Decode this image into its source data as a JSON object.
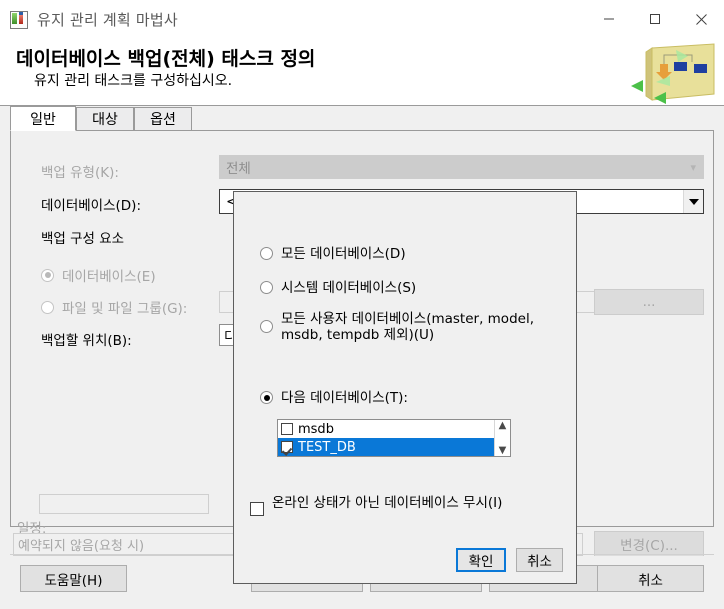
{
  "window": {
    "title": "유지 관리 계획 마법사",
    "icon": "maintenance-plan-icon",
    "minimize_label": "최소화",
    "maximize_label": "최대화",
    "close_label": "닫기"
  },
  "banner": {
    "title": "데이터베이스 백업(전체) 태스크 정의",
    "subtitle": "유지 관리 태스크를 구성하십시오."
  },
  "tabs": [
    {
      "label": "일반",
      "selected": true
    },
    {
      "label": "대상",
      "selected": false
    },
    {
      "label": "옵션",
      "selected": false
    }
  ],
  "form": {
    "backup_type_label": "백업 유형(K):",
    "backup_type_value": "전체",
    "database_label": "데이터베이스(D):",
    "database_value": "<Select one or more>",
    "backup_component_label": "백업 구성 요소",
    "radio_database": "데이터베이스(E)",
    "radio_files_filegroups": "파일 및 파일 그룹(G):",
    "files_filegroups_value": "",
    "browse_button": "...",
    "backup_location_label": "백업할 위치(B):",
    "backup_location_value": "디",
    "schedule_label": "일정:",
    "schedule_value": "예약되지 않음(요청 시)",
    "change_button": "변경(C)..."
  },
  "footer": {
    "help": "도움말(H)",
    "cancel": "취소"
  },
  "popup": {
    "options": [
      {
        "label": "모든 데이터베이스(D)",
        "selected": false
      },
      {
        "label": "시스템 데이터베이스(S)",
        "selected": false
      },
      {
        "label": "모든 사용자 데이터베이스(master, model, msdb, tempdb 제외)(U)",
        "selected": false
      },
      {
        "label": "다음 데이터베이스(T):",
        "selected": true
      }
    ],
    "database_list": [
      {
        "name": "msdb",
        "checked": false,
        "highlighted": false
      },
      {
        "name": "TEST_DB",
        "checked": true,
        "highlighted": true
      }
    ],
    "ignore_offline_label": "온라인 상태가 아닌 데이터베이스 무시(I)",
    "ignore_offline_checked": false,
    "ok_button": "확인",
    "cancel_button": "취소",
    "scroll_up": "▲",
    "scroll_down": "▼"
  },
  "colors": {
    "accent": "#0a78d7",
    "window_bg": "#f0f0f0",
    "titlebar_bg": "#ffffff",
    "selection_blue": "#0a78d7",
    "disabled_text": "#a6a6a6"
  }
}
